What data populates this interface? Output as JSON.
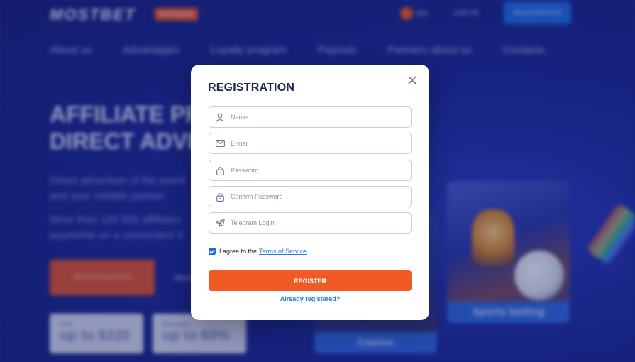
{
  "background": {
    "logo": "MOSTBET",
    "logo_badge": "PARTNERS",
    "language": "EN",
    "login": "LOG IN",
    "registration_top": "REGISTRATION",
    "nav": [
      "About us",
      "Advantages",
      "Loyalty program",
      "Payouts",
      "Partners about us",
      "Contacts"
    ],
    "hero_title_line1": "AFFILIATE PR",
    "hero_title_line2": "DIRECT ADVE",
    "hero_text": "Direct advertiser of the world and your reliable partner",
    "hero_text2": "More than 120 000 affiliates payments on a convenient d",
    "hero_button": "REGISTRATION",
    "hero_link": "More",
    "stat1_small": "CPA",
    "stat1_big": "up to $220",
    "stat2_small": "Revshare",
    "stat2_big": "up to 60%",
    "card_sports": "Sports betting",
    "card_casino": "Casino"
  },
  "modal": {
    "title": "REGISTRATION",
    "fields": {
      "name_placeholder": "Name",
      "email_placeholder": "E-mail",
      "password_placeholder": "Password",
      "confirm_placeholder": "Confirm Password",
      "telegram_placeholder": "Telegram Login"
    },
    "agree_text": "I agree to the",
    "terms_link": "Terms of Service",
    "register_button": "REGISTER",
    "already_link": "Already registered?"
  },
  "colors": {
    "accent": "#f15a24",
    "link": "#1e7be0",
    "background": "#1e2a8e"
  }
}
